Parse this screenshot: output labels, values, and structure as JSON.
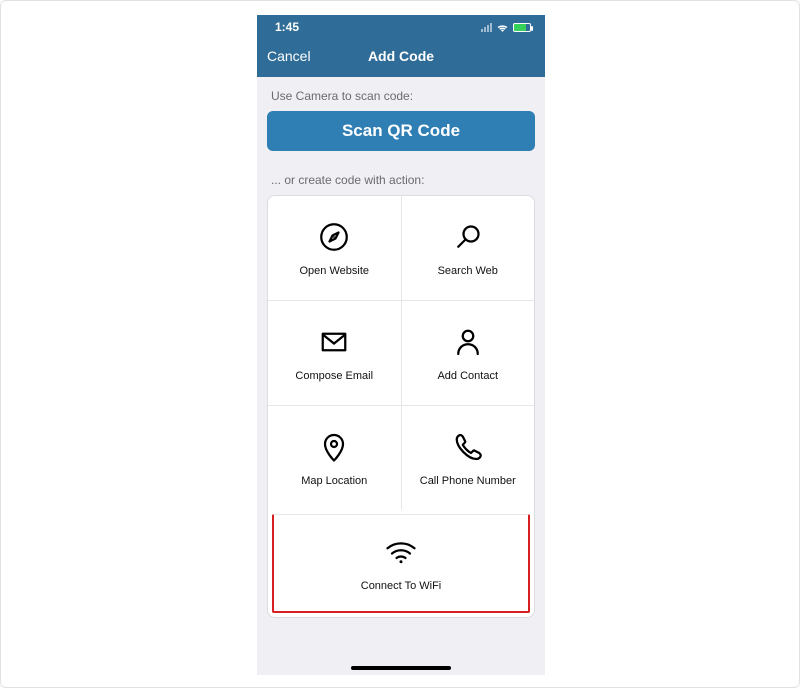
{
  "status": {
    "time": "1:45"
  },
  "nav": {
    "cancel": "Cancel",
    "title": "Add Code"
  },
  "hints": {
    "scan": "Use Camera to scan code:",
    "create": "... or create code with action:"
  },
  "scan_button": "Scan QR Code",
  "actions": {
    "open_website": "Open Website",
    "search_web": "Search Web",
    "compose_email": "Compose Email",
    "add_contact": "Add Contact",
    "map_location": "Map Location",
    "call_phone": "Call Phone Number",
    "connect_wifi": "Connect To WiFi"
  }
}
